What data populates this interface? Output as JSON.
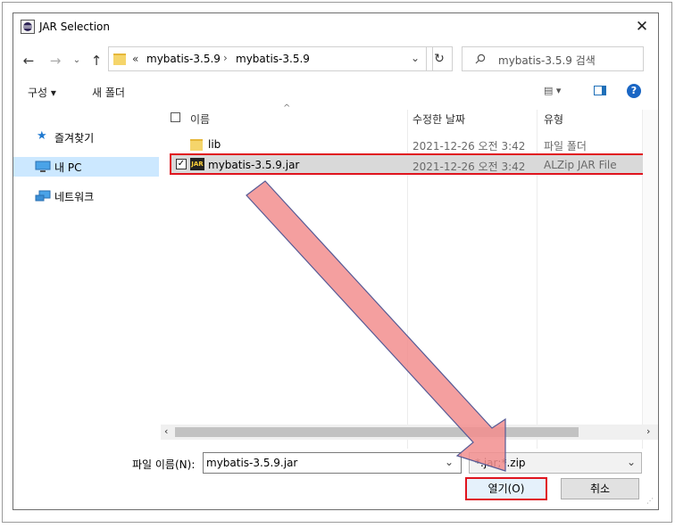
{
  "window": {
    "title": "JAR Selection"
  },
  "address_bar": {
    "overflow": "«",
    "crumbs": [
      "mybatis-3.5.9",
      "mybatis-3.5.9"
    ],
    "separator": "›"
  },
  "search": {
    "placeholder": "mybatis-3.5.9 검색"
  },
  "toolbar": {
    "organize": "구성 ▾",
    "new_folder": "새 폴더"
  },
  "sidebar": {
    "items": [
      {
        "label": "즐겨찾기",
        "icon": "star-icon",
        "selected": false
      },
      {
        "label": "내 PC",
        "icon": "pc-icon",
        "selected": true
      },
      {
        "label": "네트워크",
        "icon": "network-icon",
        "selected": false
      }
    ]
  },
  "file_list": {
    "columns": [
      "이름",
      "수정한 날짜",
      "유형"
    ],
    "rows": [
      {
        "name": "lib",
        "modified": "2021-12-26 오전 3:42",
        "type": "파일 폴더",
        "icon": "folder-icon",
        "checked": false,
        "selected": false
      },
      {
        "name": "mybatis-3.5.9.jar",
        "modified": "2021-12-26 오전 3:42",
        "type": "ALZip JAR File",
        "icon": "jar-file-icon",
        "checked": true,
        "selected": true
      }
    ]
  },
  "footer": {
    "filename_label": "파일 이름(N):",
    "filename_value": "mybatis-3.5.9.jar",
    "filter_value": "*.jar;*.zip",
    "open_button": "열기(O)",
    "cancel_button": "취소"
  },
  "colors": {
    "highlight": "#e0141e",
    "arrow": "#f28e8e",
    "selection": "#cce8ff"
  }
}
